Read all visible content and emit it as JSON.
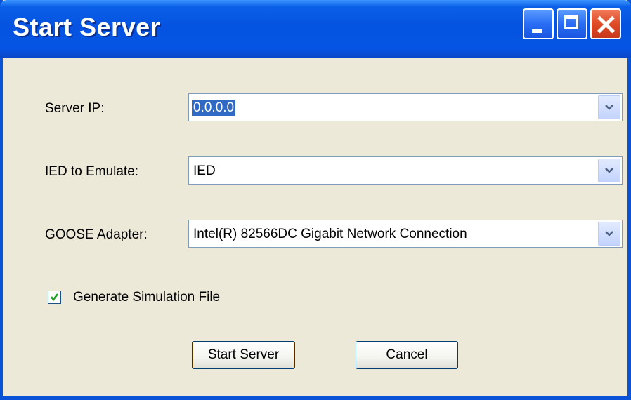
{
  "window": {
    "title": "Start Server"
  },
  "form": {
    "server_ip": {
      "label": "Server IP:",
      "value": "0.0.0.0"
    },
    "ied": {
      "label": "IED to Emulate:",
      "value": "IED"
    },
    "goose": {
      "label": "GOOSE Adapter:",
      "value": "Intel(R) 82566DC Gigabit Network Connection"
    },
    "generate_sim": {
      "label": "Generate Simulation File",
      "checked": true
    }
  },
  "buttons": {
    "start": "Start Server",
    "cancel": "Cancel"
  },
  "colors": {
    "title_bar": "#0554e3",
    "close_button": "#e04a26",
    "dialog_bg": "#ece9d8",
    "selection": "#316ac5"
  },
  "icons": [
    "minimize-icon",
    "maximize-icon",
    "close-icon",
    "chevron-down-icon",
    "checkmark-icon"
  ]
}
